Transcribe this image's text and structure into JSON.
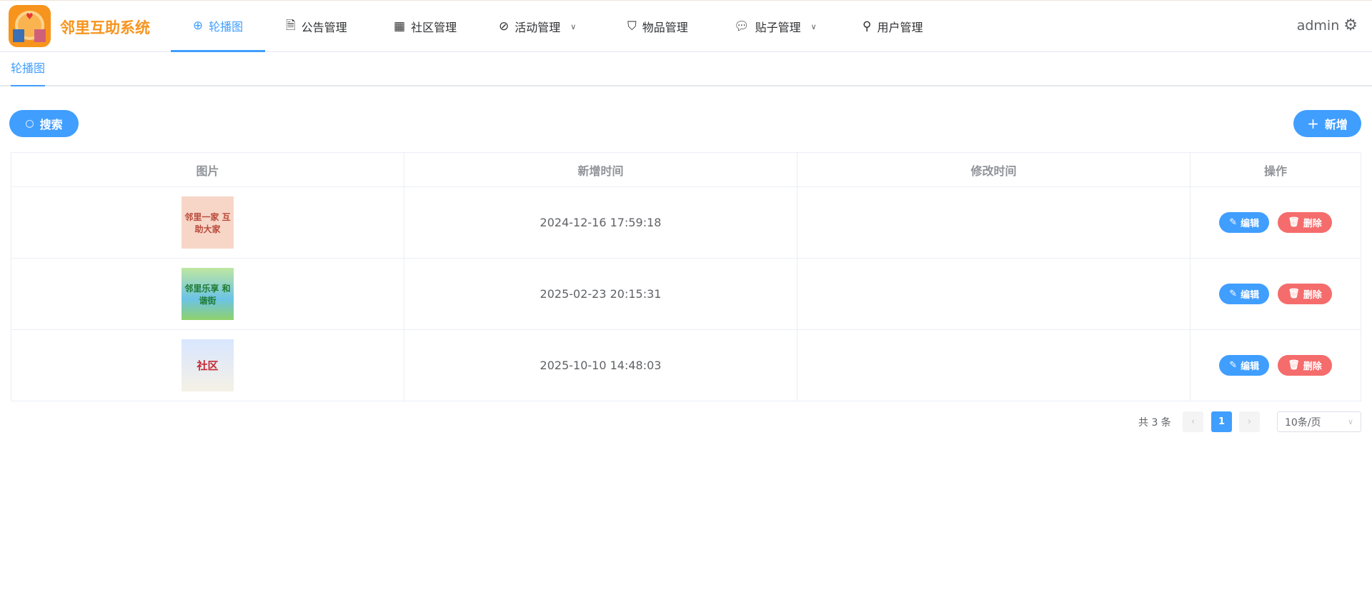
{
  "app": {
    "title": "邻里互助系统",
    "user": "admin"
  },
  "nav": [
    {
      "label": "轮播图",
      "icon": "compass-icon",
      "active": true
    },
    {
      "label": "公告管理",
      "icon": "document-icon"
    },
    {
      "label": "社区管理",
      "icon": "building-icon"
    },
    {
      "label": "活动管理",
      "icon": "link-icon",
      "dropdown": true
    },
    {
      "label": "物品管理",
      "icon": "bag-icon"
    },
    {
      "label": "贴子管理",
      "icon": "chat-icon",
      "dropdown": true
    },
    {
      "label": "用户管理",
      "icon": "user-icon"
    }
  ],
  "tabs": [
    {
      "label": "轮播图"
    }
  ],
  "toolbar": {
    "search": "搜索",
    "add": "新增"
  },
  "table": {
    "columns": [
      "图片",
      "新增时间",
      "修改时间",
      "操作"
    ],
    "rows": [
      {
        "image_text": "邻里一家 互助大家",
        "created": "2024-12-16 17:59:18",
        "modified": ""
      },
      {
        "image_text": "邻里乐享 和谐街",
        "created": "2025-02-23 20:15:31",
        "modified": ""
      },
      {
        "image_text": "社区",
        "created": "2025-10-10 14:48:03",
        "modified": ""
      }
    ],
    "edit": "编辑",
    "delete": "删除"
  },
  "pagination": {
    "total": "共 3 条",
    "current": "1",
    "page_size": "10条/页"
  },
  "colors": {
    "primary": "#409eff",
    "danger": "#f56c6c",
    "brand": "#f7941d"
  }
}
